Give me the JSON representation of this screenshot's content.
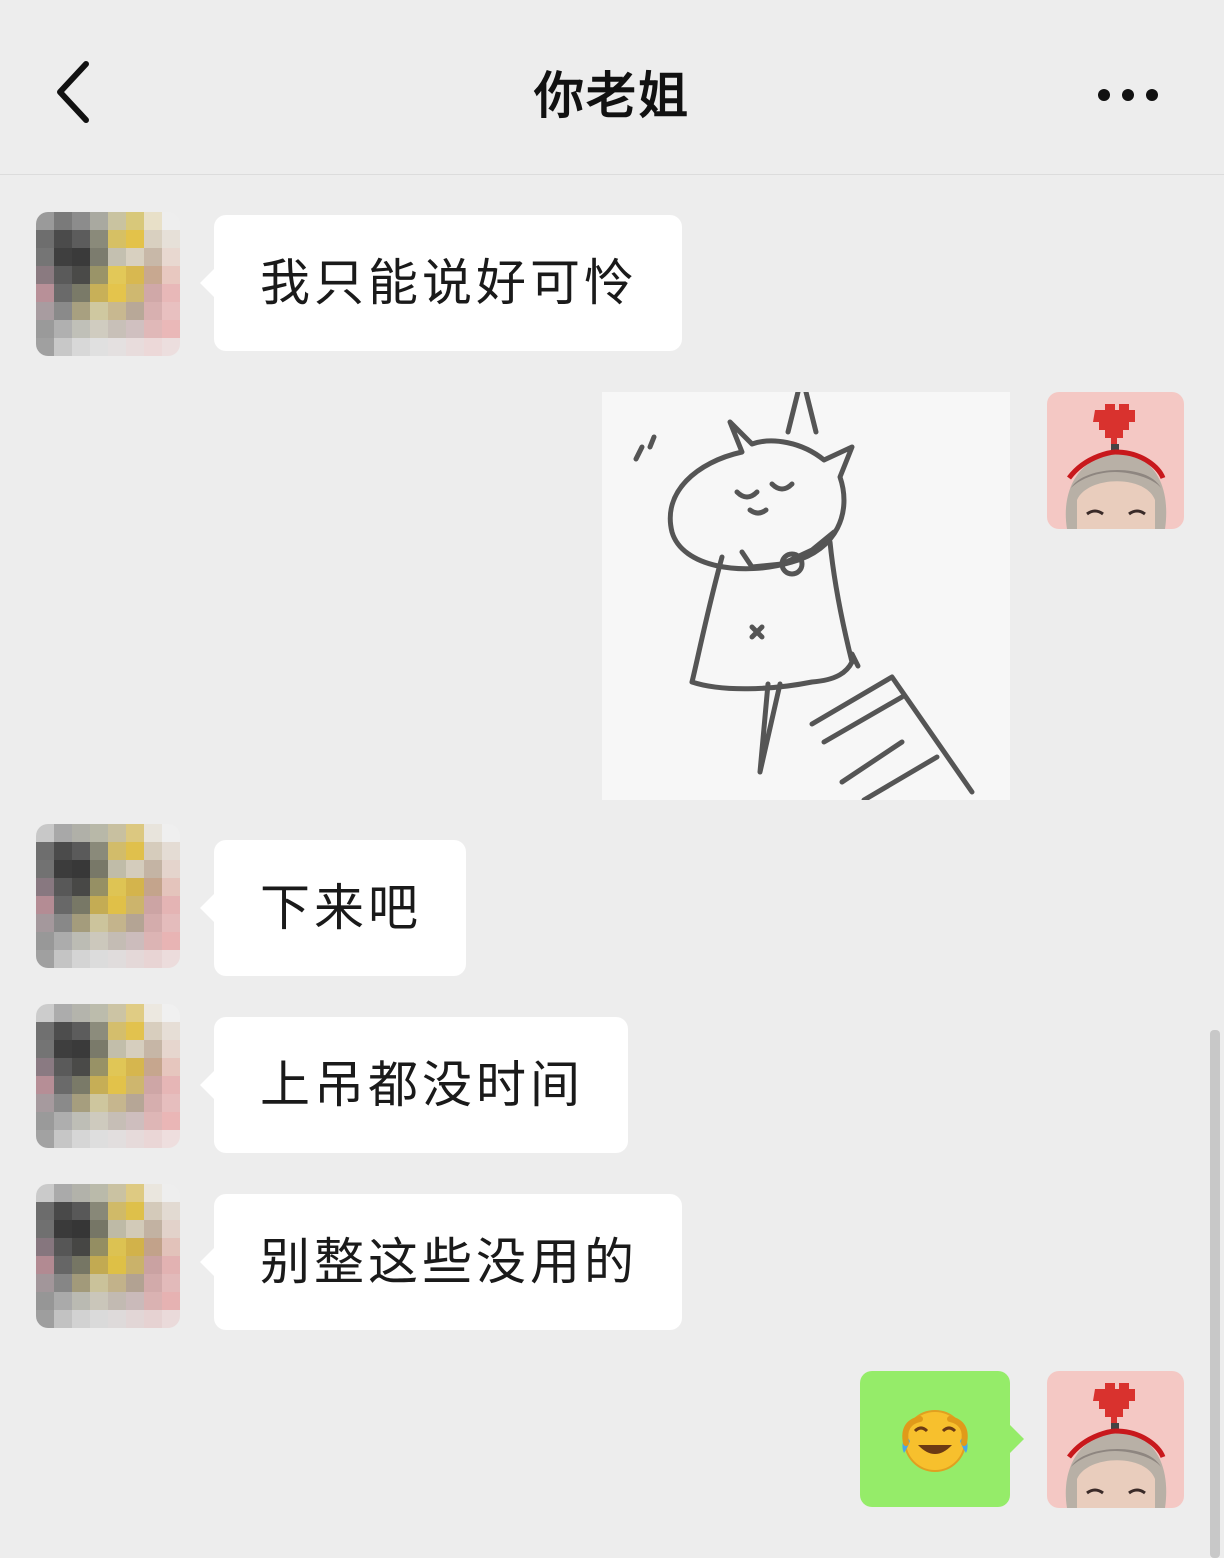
{
  "header": {
    "title": "你老姐"
  },
  "messages": [
    {
      "side": "left",
      "type": "text",
      "text": "我只能说好可怜"
    },
    {
      "side": "right",
      "type": "sticker",
      "sticker_icon": "hanging-cat-sticker"
    },
    {
      "side": "left",
      "type": "text",
      "text": "下来吧"
    },
    {
      "side": "left",
      "type": "text",
      "text": "上吊都没时间"
    },
    {
      "side": "left",
      "type": "text",
      "text": "别整这些没用的"
    },
    {
      "side": "right",
      "type": "emoji",
      "text": "😭"
    }
  ],
  "colors": {
    "background": "#ededed",
    "left_bubble": "#ffffff",
    "right_bubble": "#95ec69",
    "title": "#111111"
  },
  "icons": {
    "back": "chevron-left-icon",
    "more": "more-dots-icon"
  }
}
